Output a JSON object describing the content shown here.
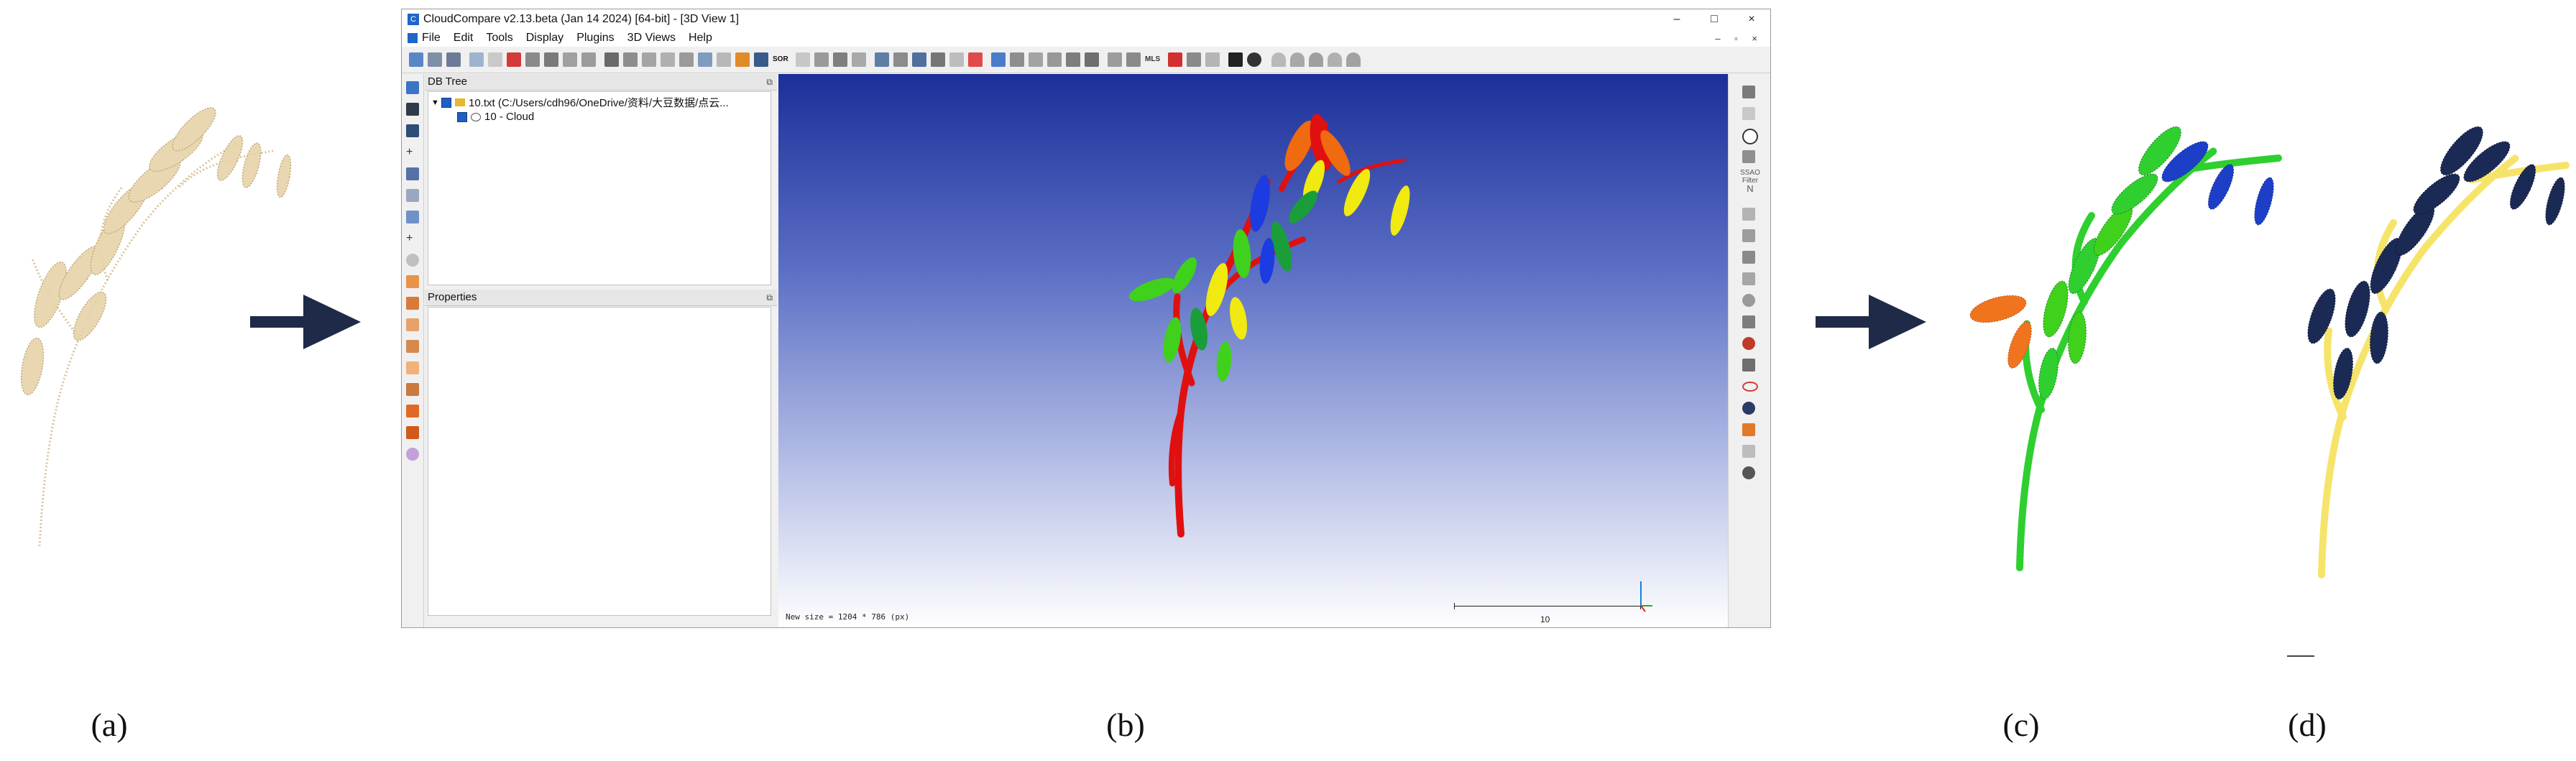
{
  "captions": {
    "a": "(a)",
    "b": "(b)",
    "c": "(c)",
    "d": "(d)"
  },
  "colors": {
    "arrow": "#1f2a48",
    "raw_cloud": "#d8c49a",
    "seg_red": "#e01010",
    "seg_green": "#3fd11c",
    "seg_blue": "#1c3be0",
    "seg_yellow": "#f0ea10",
    "seg_orange": "#f06a10",
    "seg_darkgreen": "#1a9e3a",
    "heat_green": "#2fcf2f",
    "heat_blue": "#1d3fc8",
    "heat_orange": "#f0741e",
    "binary_yellow": "#f6e46a",
    "binary_navy": "#1b2a55"
  },
  "window": {
    "title": "CloudCompare v2.13.beta (Jan 14 2024) [64-bit] - [3D View 1]",
    "controls": [
      "–",
      "□",
      "×"
    ],
    "menu": [
      "File",
      "Edit",
      "Tools",
      "Display",
      "Plugins",
      "3D Views",
      "Help"
    ],
    "mdi_controls": "– ▫ ×"
  },
  "db_tree": {
    "title": "DB Tree",
    "root_label": "10.txt (C:/Users/cdh96/OneDrive/资料/大豆数据/点云...",
    "child_label": "10 - Cloud"
  },
  "properties": {
    "title": "Properties"
  },
  "view3d": {
    "size_text": "New size = 1204 * 786 (px)",
    "scale_label": "10"
  },
  "right_toolbar": {
    "ssao_label": "SSAO Filter",
    "north_label": "N"
  },
  "toolbar_badges": {
    "sor": "SOR",
    "mls": "MLS"
  }
}
